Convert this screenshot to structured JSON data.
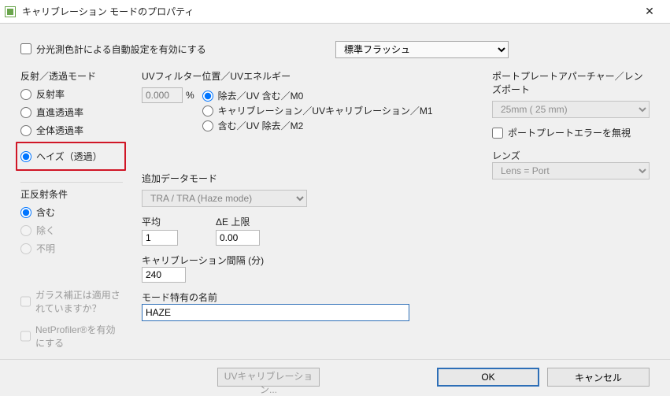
{
  "window": {
    "title": "キャリブレーション モードのプロパティ"
  },
  "auto_set": {
    "label": "分光測色計による自動設定を有効にする"
  },
  "flash_select": {
    "value": "標準フラッシュ"
  },
  "modes": {
    "label": "反射／透過モード",
    "reflectance": "反射率",
    "direct_trans": "直進透過率",
    "total_trans": "全体透過率",
    "haze": "ヘイズ（透過）"
  },
  "specular": {
    "label": "正反射条件",
    "included": "含む",
    "excluded": "除く",
    "unknown": "不明"
  },
  "glass": {
    "label": "ガラス補正は適用されていますか？"
  },
  "netprofiler": {
    "label": "NetProfiler®を有効にする"
  },
  "uvfilter": {
    "label": "UVフィルター位置／UVエネルギー",
    "value": "0.000",
    "unit": "%",
    "opt0": "除去／UV 含む／M0",
    "opt1": "キャリブレーション／UVキャリブレーション／M1",
    "opt2": "含む／UV 除去／M2"
  },
  "extra": {
    "label": "追加データモード",
    "select": "TRA / TRA (Haze mode)"
  },
  "avg": {
    "label": "平均",
    "value": "1"
  },
  "delim": {
    "label": "ΔE 上限",
    "value": "0.00"
  },
  "interval": {
    "label": "キャリブレーション間隔 (分)",
    "value": "240"
  },
  "mode_name": {
    "label": "モード特有の名前",
    "value": "HAZE"
  },
  "port": {
    "label": "ポートプレートアパーチャー／レンズポート",
    "select": "25mm (  25 mm)",
    "ignore_err": "ポートプレートエラーを無視",
    "lens_label": "レンズ",
    "lens_select": "Lens = Port"
  },
  "buttons": {
    "uv_cal": "UVキャリブレーション...",
    "ok": "OK",
    "cancel": "キャンセル"
  }
}
